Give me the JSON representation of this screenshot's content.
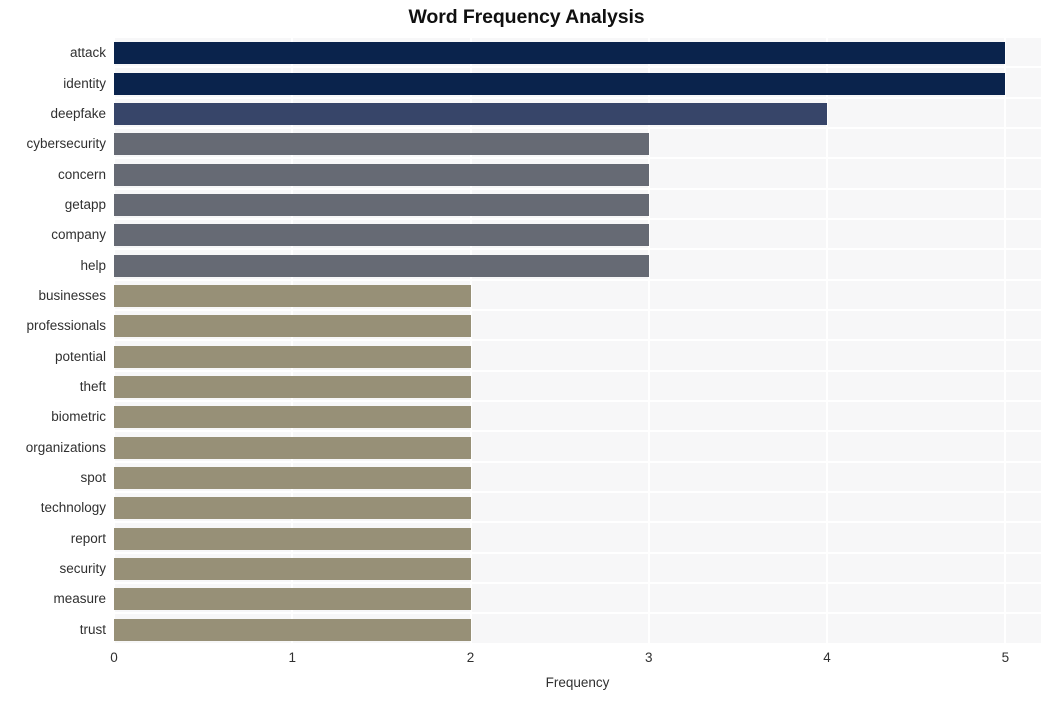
{
  "chart_data": {
    "type": "bar",
    "orientation": "horizontal",
    "title": "Word Frequency Analysis",
    "xlabel": "Frequency",
    "ylabel": "",
    "xlim": [
      0,
      5.2
    ],
    "xticks": [
      0,
      1,
      2,
      3,
      4,
      5
    ],
    "xtick_labels": [
      "0",
      "1",
      "2",
      "3",
      "4",
      "5"
    ],
    "grid": true,
    "grid_axis": "both",
    "legend": false,
    "categories": [
      "attack",
      "identity",
      "deepfake",
      "cybersecurity",
      "concern",
      "getapp",
      "company",
      "help",
      "businesses",
      "professionals",
      "potential",
      "theft",
      "biometric",
      "organizations",
      "spot",
      "technology",
      "report",
      "security",
      "measure",
      "trust"
    ],
    "values": [
      5,
      5,
      4,
      3,
      3,
      3,
      3,
      3,
      2,
      2,
      2,
      2,
      2,
      2,
      2,
      2,
      2,
      2,
      2,
      2
    ],
    "bar_colors": [
      "#0a234c",
      "#0a234c",
      "#374569",
      "#666a74",
      "#666a74",
      "#666a74",
      "#666a74",
      "#666a74",
      "#979077",
      "#979077",
      "#979077",
      "#979077",
      "#979077",
      "#979077",
      "#979077",
      "#979077",
      "#979077",
      "#979077",
      "#979077",
      "#979077"
    ]
  },
  "style": {
    "plot_background": "#f7f7f8",
    "figure_background": "#ffffff",
    "gridline_color": "#ffffff",
    "text_color": "#303030",
    "title_color": "#101010"
  }
}
